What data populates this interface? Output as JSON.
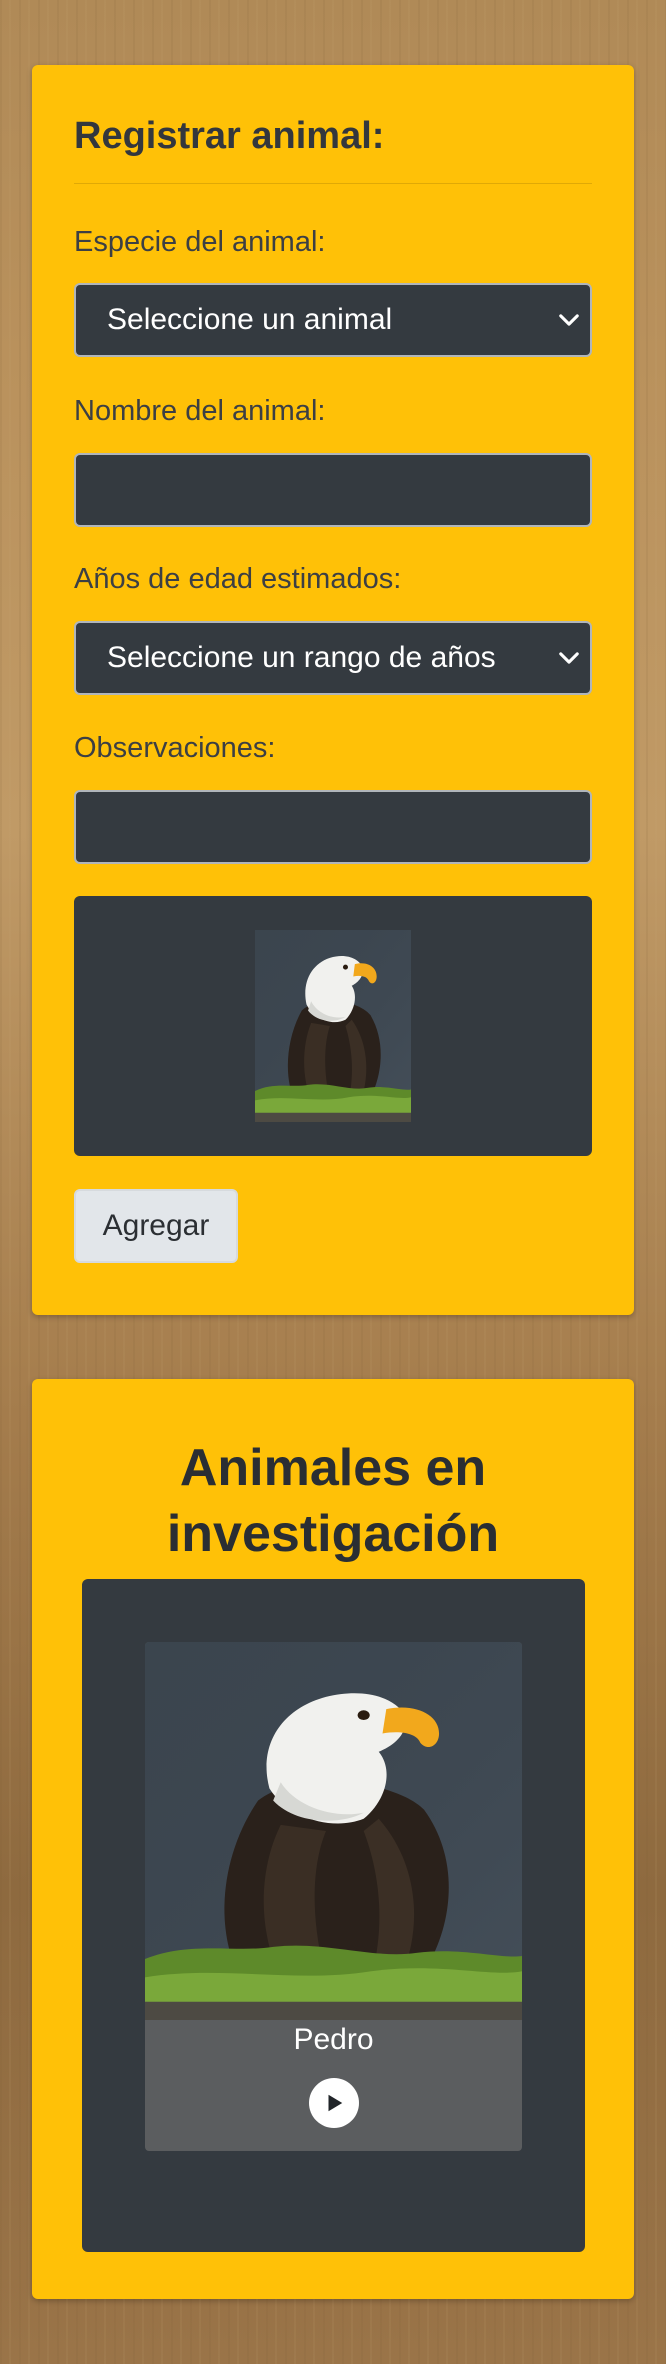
{
  "form": {
    "title": "Registrar animal:",
    "species_label": "Especie del animal:",
    "species_selected": "Seleccione un animal",
    "name_label": "Nombre del animal:",
    "name_value": "",
    "age_label": "Años de edad estimados:",
    "age_selected": "Seleccione un rango de años",
    "observations_label": "Observaciones:",
    "observations_value": "",
    "preview_image": "eagle-image",
    "add_button": "Agregar"
  },
  "research": {
    "title_line1": "Animales en",
    "title_line2": "investigación",
    "animals": [
      {
        "name": "Pedro",
        "image": "eagle-image",
        "action_icon": "play-icon"
      }
    ]
  },
  "colors": {
    "card_bg": "#ffc107",
    "dark_panel": "#343a40",
    "button_bg": "#e2e6ea"
  }
}
